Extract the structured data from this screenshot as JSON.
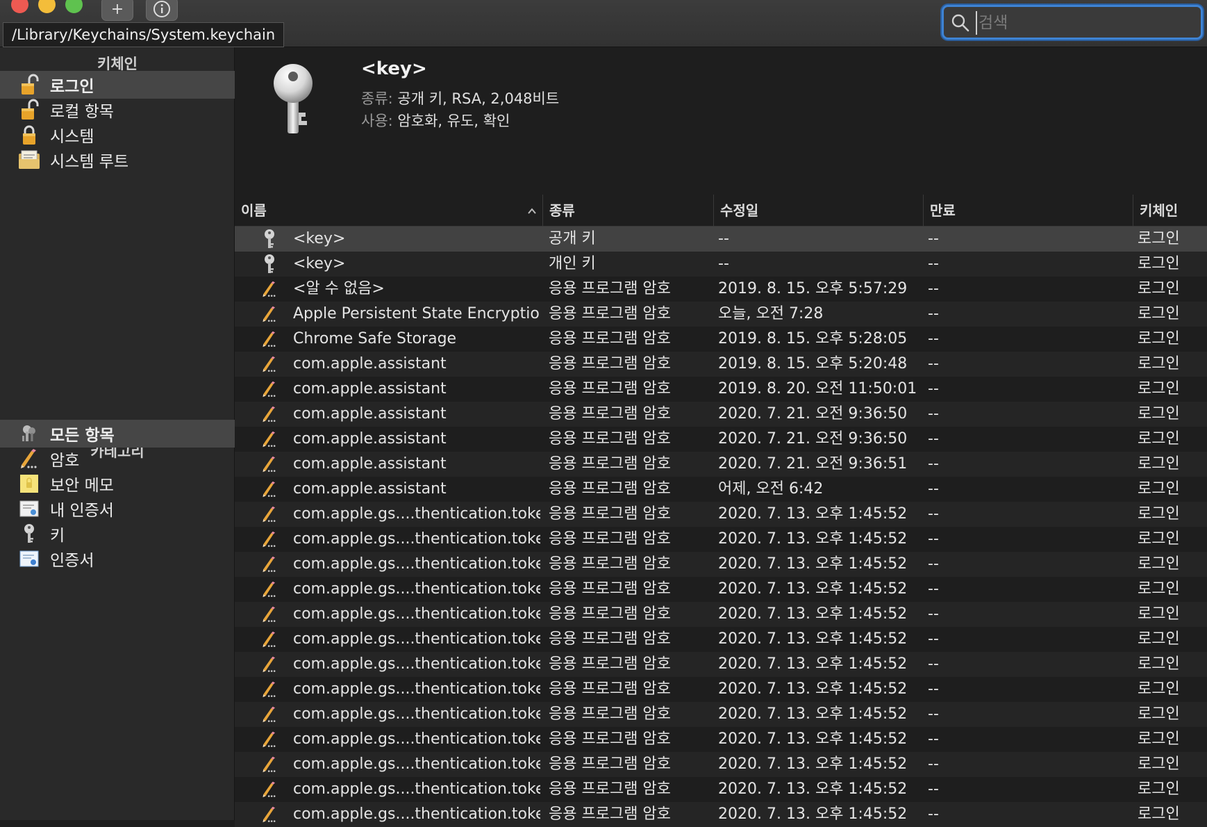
{
  "window": {
    "path_tooltip": "/Library/Keychains/System.keychain",
    "toolbar": {
      "add_label": "+",
      "info_label": "i"
    },
    "search": {
      "placeholder": "검색",
      "value": ""
    }
  },
  "sidebar": {
    "keychains_header": "키체인",
    "keychains": [
      {
        "label": "로그인",
        "icon": "unlocked-padlock-icon",
        "selected": true
      },
      {
        "label": "로컬 항목",
        "icon": "unlocked-padlock-icon",
        "selected": false
      },
      {
        "label": "시스템",
        "icon": "locked-padlock-icon",
        "selected": false
      },
      {
        "label": "시스템 루트",
        "icon": "certificate-folder-icon",
        "selected": false
      }
    ],
    "category_header": "카테고리",
    "categories": [
      {
        "label": "모든 항목",
        "icon": "all-items-icon",
        "selected": true
      },
      {
        "label": "암호",
        "icon": "password-pencil-icon",
        "selected": false
      },
      {
        "label": "보안 메모",
        "icon": "secure-note-icon",
        "selected": false
      },
      {
        "label": "내 인증서",
        "icon": "my-certificate-icon",
        "selected": false
      },
      {
        "label": "키",
        "icon": "key-icon",
        "selected": false
      },
      {
        "label": "인증서",
        "icon": "certificate-icon",
        "selected": false
      }
    ]
  },
  "detail": {
    "title": "<key>",
    "kind_label": "종류:",
    "kind_value": "공개 키, RSA, 2,048비트",
    "usage_label": "사용:",
    "usage_value": "암호화, 유도, 확인",
    "icon": "large-key-icon"
  },
  "table": {
    "columns": [
      "이름",
      "종류",
      "수정일",
      "만료",
      "키체인"
    ],
    "sorted_column": "이름",
    "rows": [
      {
        "icon": "key-icon",
        "name": "<key>",
        "kind": "공개 키",
        "modified": "--",
        "expires": "--",
        "keychain": "로그인",
        "selected": true
      },
      {
        "icon": "key-icon",
        "name": "<key>",
        "kind": "개인 키",
        "modified": "--",
        "expires": "--",
        "keychain": "로그인"
      },
      {
        "icon": "password-pencil-icon",
        "name": "<알 수 없음>",
        "kind": "응용 프로그램 암호",
        "modified": "2019. 8. 15. 오후 5:57:29",
        "expires": "--",
        "keychain": "로그인"
      },
      {
        "icon": "password-pencil-icon",
        "name": "Apple Persistent State Encryption",
        "kind": "응용 프로그램 암호",
        "modified": "오늘, 오전 7:28",
        "expires": "--",
        "keychain": "로그인"
      },
      {
        "icon": "password-pencil-icon",
        "name": "Chrome Safe Storage",
        "kind": "응용 프로그램 암호",
        "modified": "2019. 8. 15. 오후 5:28:05",
        "expires": "--",
        "keychain": "로그인"
      },
      {
        "icon": "password-pencil-icon",
        "name": "com.apple.assistant",
        "kind": "응용 프로그램 암호",
        "modified": "2019. 8. 15. 오후 5:20:48",
        "expires": "--",
        "keychain": "로그인"
      },
      {
        "icon": "password-pencil-icon",
        "name": "com.apple.assistant",
        "kind": "응용 프로그램 암호",
        "modified": "2019. 8. 20. 오전 11:50:01",
        "expires": "--",
        "keychain": "로그인"
      },
      {
        "icon": "password-pencil-icon",
        "name": "com.apple.assistant",
        "kind": "응용 프로그램 암호",
        "modified": "2020. 7. 21. 오전 9:36:50",
        "expires": "--",
        "keychain": "로그인"
      },
      {
        "icon": "password-pencil-icon",
        "name": "com.apple.assistant",
        "kind": "응용 프로그램 암호",
        "modified": "2020. 7. 21. 오전 9:36:50",
        "expires": "--",
        "keychain": "로그인"
      },
      {
        "icon": "password-pencil-icon",
        "name": "com.apple.assistant",
        "kind": "응용 프로그램 암호",
        "modified": "2020. 7. 21. 오전 9:36:51",
        "expires": "--",
        "keychain": "로그인"
      },
      {
        "icon": "password-pencil-icon",
        "name": "com.apple.assistant",
        "kind": "응용 프로그램 암호",
        "modified": "어제, 오전 6:42",
        "expires": "--",
        "keychain": "로그인"
      },
      {
        "icon": "password-pencil-icon",
        "name": "com.apple.gs....thentication.token",
        "kind": "응용 프로그램 암호",
        "modified": "2020. 7. 13. 오후 1:45:52",
        "expires": "--",
        "keychain": "로그인"
      },
      {
        "icon": "password-pencil-icon",
        "name": "com.apple.gs....thentication.token",
        "kind": "응용 프로그램 암호",
        "modified": "2020. 7. 13. 오후 1:45:52",
        "expires": "--",
        "keychain": "로그인"
      },
      {
        "icon": "password-pencil-icon",
        "name": "com.apple.gs....thentication.token",
        "kind": "응용 프로그램 암호",
        "modified": "2020. 7. 13. 오후 1:45:52",
        "expires": "--",
        "keychain": "로그인"
      },
      {
        "icon": "password-pencil-icon",
        "name": "com.apple.gs....thentication.token",
        "kind": "응용 프로그램 암호",
        "modified": "2020. 7. 13. 오후 1:45:52",
        "expires": "--",
        "keychain": "로그인"
      },
      {
        "icon": "password-pencil-icon",
        "name": "com.apple.gs....thentication.token",
        "kind": "응용 프로그램 암호",
        "modified": "2020. 7. 13. 오후 1:45:52",
        "expires": "--",
        "keychain": "로그인"
      },
      {
        "icon": "password-pencil-icon",
        "name": "com.apple.gs....thentication.token",
        "kind": "응용 프로그램 암호",
        "modified": "2020. 7. 13. 오후 1:45:52",
        "expires": "--",
        "keychain": "로그인"
      },
      {
        "icon": "password-pencil-icon",
        "name": "com.apple.gs....thentication.token",
        "kind": "응용 프로그램 암호",
        "modified": "2020. 7. 13. 오후 1:45:52",
        "expires": "--",
        "keychain": "로그인"
      },
      {
        "icon": "password-pencil-icon",
        "name": "com.apple.gs....thentication.token",
        "kind": "응용 프로그램 암호",
        "modified": "2020. 7. 13. 오후 1:45:52",
        "expires": "--",
        "keychain": "로그인"
      },
      {
        "icon": "password-pencil-icon",
        "name": "com.apple.gs....thentication.token",
        "kind": "응용 프로그램 암호",
        "modified": "2020. 7. 13. 오후 1:45:52",
        "expires": "--",
        "keychain": "로그인"
      },
      {
        "icon": "password-pencil-icon",
        "name": "com.apple.gs....thentication.token",
        "kind": "응용 프로그램 암호",
        "modified": "2020. 7. 13. 오후 1:45:52",
        "expires": "--",
        "keychain": "로그인"
      },
      {
        "icon": "password-pencil-icon",
        "name": "com.apple.gs....thentication.token",
        "kind": "응용 프로그램 암호",
        "modified": "2020. 7. 13. 오후 1:45:52",
        "expires": "--",
        "keychain": "로그인"
      },
      {
        "icon": "password-pencil-icon",
        "name": "com.apple.gs....thentication.token",
        "kind": "응용 프로그램 암호",
        "modified": "2020. 7. 13. 오후 1:45:52",
        "expires": "--",
        "keychain": "로그인"
      },
      {
        "icon": "password-pencil-icon",
        "name": "com.apple.gs....thentication.token",
        "kind": "응용 프로그램 암호",
        "modified": "2020. 7. 13. 오후 1:45:52",
        "expires": "--",
        "keychain": "로그인"
      }
    ]
  },
  "colors": {
    "window_bg": "#1e1e1e",
    "sidebar_bg": "#292929",
    "selection": "#464646",
    "search_focus": "#3e83d4",
    "padlock_gold": "#e7a32a",
    "close": "#ee5a52",
    "minimize": "#f3bd3a",
    "maximize": "#5fc24f"
  }
}
